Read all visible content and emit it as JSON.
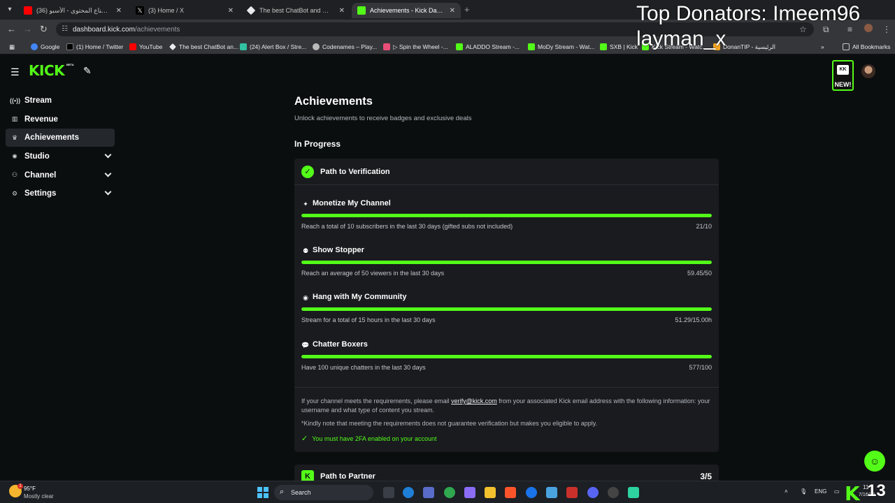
{
  "browser": {
    "tabs": [
      {
        "title": "(36) دوري صناع المحتوى - الأسبو",
        "color": "#ff0000"
      },
      {
        "title": "(3) Home / X",
        "color": "#ffffff"
      },
      {
        "title": "The best ChatBot and Widgets",
        "color": "#e8eaed"
      },
      {
        "title": "Achievements - Kick Dashboard",
        "color": "#53fc18",
        "active": true
      }
    ],
    "url_host": "dashboard.kick.com",
    "url_path": "/achievements",
    "bookmarks": [
      {
        "label": "Google",
        "color": "#4285f4"
      },
      {
        "label": "(1) Home / Twitter",
        "color": "#ffffff"
      },
      {
        "label": "YouTube",
        "color": "#ff0000"
      },
      {
        "label": "The best ChatBot an...",
        "color": "#e8eaed"
      },
      {
        "label": "(24) Alert Box / Stre...",
        "color": "#31c3a2"
      },
      {
        "label": "Codenames – Play...",
        "color": "#bbbbbb"
      },
      {
        "label": "▷ Spin the Wheel -...",
        "color": "#e94e77"
      },
      {
        "label": "ALADDO Stream -...",
        "color": "#53fc18"
      },
      {
        "label": "MoDy Stream - Wat...",
        "color": "#53fc18"
      },
      {
        "label": "SXB | Kick",
        "color": "#53fc18"
      },
      {
        "label": "Kick Stream - Watc...",
        "color": "#53fc18"
      },
      {
        "label": "DonanTIP - الرئيسية",
        "color": "#f5a623"
      }
    ],
    "all_bookmarks": "All Bookmarks"
  },
  "sidebar": {
    "items": [
      {
        "label": "Stream",
        "icon": "broadcast-icon"
      },
      {
        "label": "Revenue",
        "icon": "chart-icon"
      },
      {
        "label": "Achievements",
        "icon": "trophy-icon",
        "active": true
      },
      {
        "label": "Studio",
        "icon": "palette-icon",
        "expandable": true
      },
      {
        "label": "Channel",
        "icon": "people-icon",
        "expandable": true
      },
      {
        "label": "Settings",
        "icon": "gear-icon",
        "expandable": true
      }
    ]
  },
  "header": {
    "badge_new": "NEW!",
    "badge_logo": "KK"
  },
  "main": {
    "title": "Achievements",
    "subtitle": "Unlock achievements to receive badges and exclusive deals",
    "section": "In Progress",
    "verification": {
      "title": "Path to Verification",
      "requirements": [
        {
          "title": "Monetize My Channel",
          "icon": "sparkle-icon",
          "description": "Reach a total of 10 subscribers in the last 30 days (gifted subs not included)",
          "value": "21/10",
          "progress": 1.0
        },
        {
          "title": "Show Stopper",
          "icon": "viewers-icon",
          "description": "Reach an average of 50 viewers in the last 30 days",
          "value": "59.45/50",
          "progress": 1.0
        },
        {
          "title": "Hang with My Community",
          "icon": "broadcast-icon",
          "description": "Stream for a total of 15 hours in the last 30 days",
          "value": "51.29/15.00h",
          "progress": 1.0
        },
        {
          "title": "Chatter Boxers",
          "icon": "chat-icon",
          "description": "Have 100 unique chatters in the last 30 days",
          "value": "577/100",
          "progress": 1.0
        }
      ],
      "note_before": "If your channel meets the requirements, please email ",
      "note_link": "verify@kick.com",
      "note_after": " from your associated Kick email address with the following information: your username and what type of content you stream.",
      "note_disclaimer": "*Kindly note that meeting the requirements does not guarantee verification but makes you eligible to apply.",
      "twofa": "You must have 2FA enabled on your account"
    },
    "partner": {
      "title": "Path to Partner",
      "value": "3/5"
    }
  },
  "overlay": {
    "text": "Top Donators: Imeem96\nlayman_x"
  },
  "taskbar": {
    "temperature": "95°F",
    "weather": "Mostly clear",
    "weather_badge": "1",
    "search": "Search",
    "lang": "ENG",
    "clock": "11",
    "date": "7/16/20",
    "stream_count": "13"
  },
  "colors": {
    "accent": "#53fc18",
    "card": "#191b1f",
    "background": "#0b0e0f"
  }
}
